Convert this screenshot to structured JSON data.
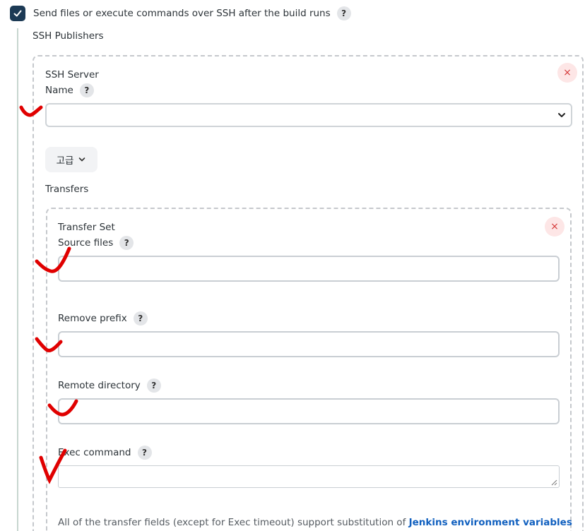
{
  "checkbox": {
    "checked": true,
    "label": "Send files or execute commands over SSH after the build runs",
    "help": "?"
  },
  "section_title": "SSH Publishers",
  "ssh_server": {
    "heading": "SSH Server",
    "name_label": "Name",
    "name_help": "?",
    "name_value": "",
    "advanced_label": "고급",
    "transfers_label": "Transfers",
    "remove_icon": "×"
  },
  "transfer_set": {
    "heading": "Transfer Set",
    "remove_icon": "×",
    "source_files": {
      "label": "Source files",
      "help": "?",
      "value": ""
    },
    "remove_prefix": {
      "label": "Remove prefix",
      "help": "?",
      "value": ""
    },
    "remote_directory": {
      "label": "Remote directory",
      "help": "?",
      "value": ""
    },
    "exec_command": {
      "label": "Exec command",
      "help": "?",
      "value": ""
    }
  },
  "footer": {
    "text": "All of the transfer fields (except for Exec timeout) support substitution of ",
    "link": "Jenkins environment variables"
  },
  "colors": {
    "accent": "#1c3a55",
    "danger": "#d63a3a",
    "link": "#1160bf",
    "annotation": "#e00000"
  }
}
